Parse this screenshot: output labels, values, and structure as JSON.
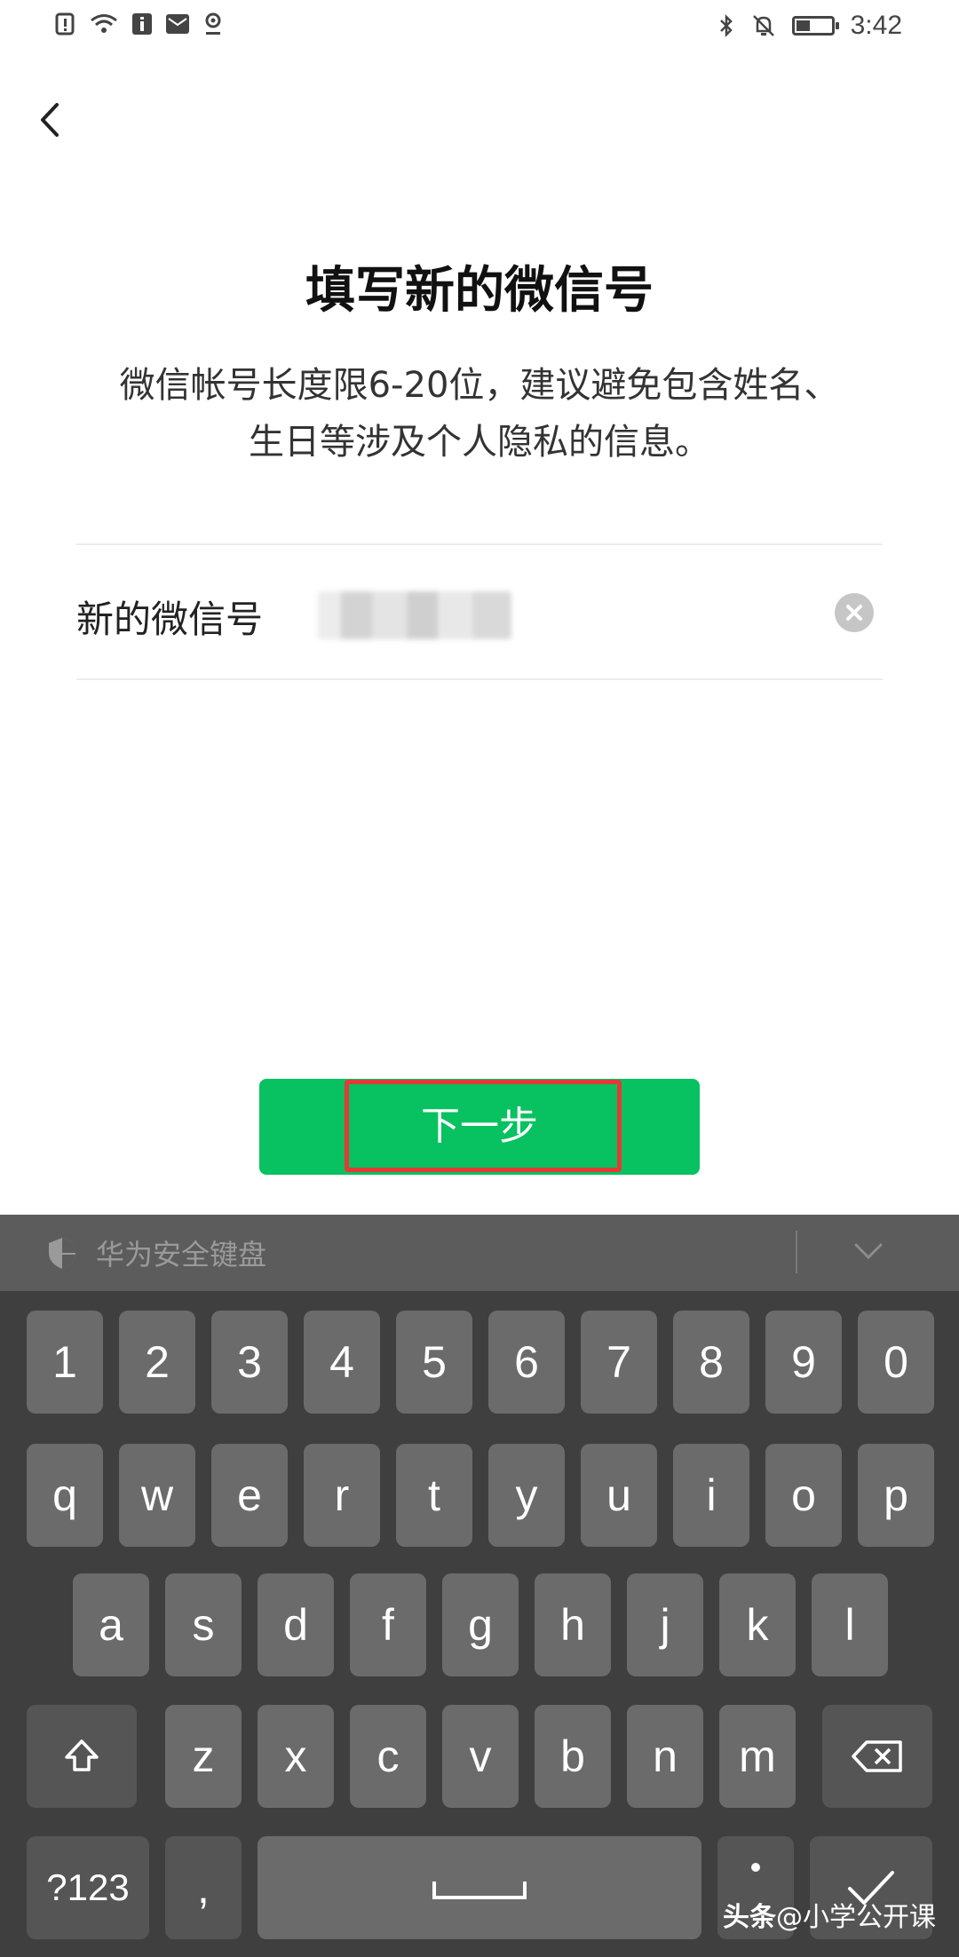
{
  "status_bar": {
    "time": "3:42",
    "left_icons": [
      "alert-icon",
      "wifi-icon",
      "info-icon",
      "mail-icon",
      "location-icon"
    ],
    "right_icons": [
      "bluetooth-icon",
      "bell-mute-icon",
      "battery-icon"
    ],
    "battery_level": 0.4
  },
  "page": {
    "title": "填写新的微信号",
    "description_line1": "微信帐号长度限6-20位，建议避免包含姓名、",
    "description_line2": "生日等涉及个人隐私的信息。"
  },
  "form": {
    "label": "新的微信号",
    "value_obscured": true
  },
  "next_button": {
    "label": "下一步"
  },
  "keyboard": {
    "title": "华为安全键盘",
    "row1": [
      "1",
      "2",
      "3",
      "4",
      "5",
      "6",
      "7",
      "8",
      "9",
      "0"
    ],
    "row2": [
      "q",
      "w",
      "e",
      "r",
      "t",
      "y",
      "u",
      "i",
      "o",
      "p"
    ],
    "row3": [
      "a",
      "s",
      "d",
      "f",
      "g",
      "h",
      "j",
      "k",
      "l"
    ],
    "row4": [
      "z",
      "x",
      "c",
      "v",
      "b",
      "n",
      "m"
    ],
    "symbol_key": "?123",
    "comma_key": ",",
    "shift_icon": "shift-icon",
    "backspace_icon": "backspace-icon",
    "space_icon": "space-icon",
    "confirm_icon": "check-icon"
  },
  "watermark": {
    "brand": "头条",
    "handle": "@小学公开课"
  },
  "colors": {
    "primary_green": "#08c160",
    "highlight_red": "#e53935",
    "keyboard_bg": "#3f3f3f",
    "key_bg": "#6b6b6b"
  }
}
